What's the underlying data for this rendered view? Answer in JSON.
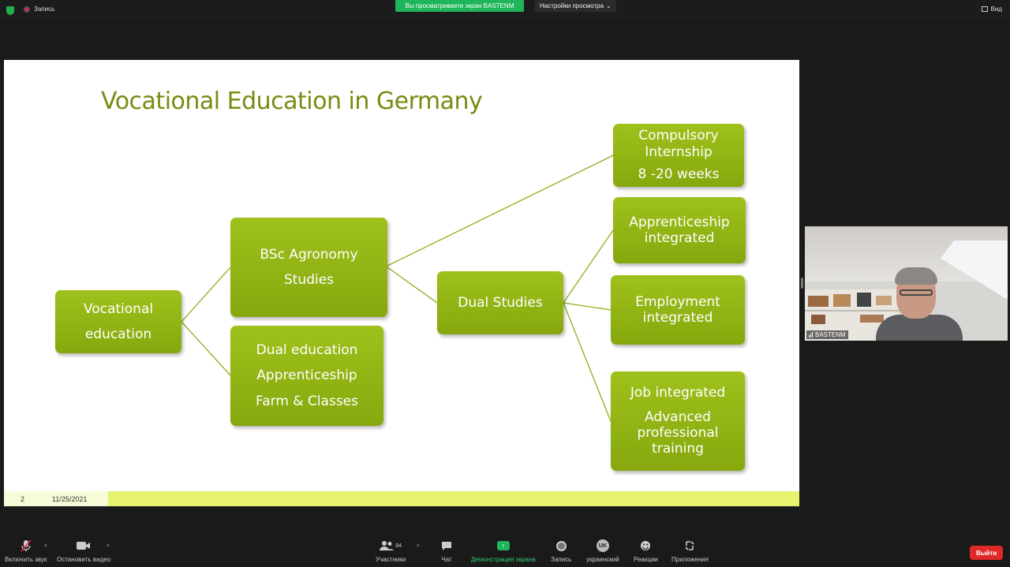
{
  "topbar": {
    "recording_label": "Запись",
    "share_banner": "Вы просматриваете экран BASTENM",
    "view_settings": "Настройки просмотра",
    "view_label": "Вид"
  },
  "slide": {
    "title": "Vocational Education in Germany",
    "boxes": {
      "vocational": [
        "Vocational",
        "education"
      ],
      "bsc": [
        "BSc Agronomy",
        "Studies"
      ],
      "dual_education": [
        "Dual education",
        "Apprenticeship",
        "Farm & Classes"
      ],
      "dual_studies": [
        "Dual Studies"
      ],
      "compulsory": [
        "Compulsory",
        "Internship",
        "8 -20 weeks"
      ],
      "apprenticeship": [
        "Apprenticeship",
        "integrated"
      ],
      "employment": [
        "Employment",
        "integrated"
      ],
      "job": [
        "Job integrated",
        "Advanced",
        "professional",
        "training"
      ]
    },
    "footer": {
      "slide_number": "2",
      "date": "11/25/2021"
    }
  },
  "participant": {
    "name": "BASTENM"
  },
  "toolbar": {
    "audio": "Включить звук",
    "video": "Остановить видео",
    "participants": "Участники",
    "participants_count": "84",
    "chat": "Чат",
    "share": "Демонстрация экрана",
    "record": "Запись",
    "language": "украинский",
    "language_code": "UK",
    "reactions": "Реакции",
    "apps": "Приложения",
    "leave": "Выйти"
  },
  "colors": {
    "accent_green": "#1fb55b",
    "slide_title": "#7a8a12",
    "box_fill": "#93b515",
    "footer_bar": "#e5f36f",
    "leave_red": "#e02828"
  }
}
